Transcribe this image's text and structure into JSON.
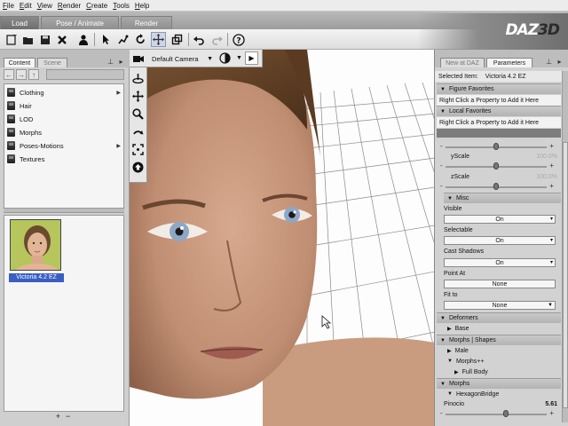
{
  "menu": [
    "File",
    "Edit",
    "View",
    "Render",
    "Create",
    "Tools",
    "Help"
  ],
  "main_tabs": [
    {
      "label": "Load",
      "active": true
    },
    {
      "label": "Pose / Animate",
      "active": false
    },
    {
      "label": "Render",
      "active": false
    }
  ],
  "brand": {
    "part1": "DAZ",
    "part2": "3D"
  },
  "toolbar_icons": [
    "new-scene-icon",
    "open-icon",
    "save-icon",
    "delete-icon",
    "figure-setup-icon",
    "select-tool-icon",
    "node-tool-icon",
    "rotate-tool-icon",
    "translate-tool-icon",
    "scale-tool-icon",
    "undo-icon",
    "redo-icon",
    "help-icon"
  ],
  "left_panel": {
    "tabs": [
      {
        "label": "Content",
        "active": true
      },
      {
        "label": "Scene",
        "active": false
      }
    ],
    "folders": [
      {
        "label": "Clothing",
        "has_children": true
      },
      {
        "label": "Hair",
        "has_children": false
      },
      {
        "label": "LOD",
        "has_children": false
      },
      {
        "label": "Morphs",
        "has_children": false
      },
      {
        "label": "Poses-Motions",
        "has_children": true
      },
      {
        "label": "Textures",
        "has_children": false
      }
    ],
    "thumbnail": {
      "caption": "Victoria 4.2 EZ"
    },
    "add_label": "+",
    "remove_label": "−"
  },
  "viewport": {
    "camera": "Default Camera"
  },
  "right_panel": {
    "tabs": [
      {
        "label": "New at DAZ",
        "active": false
      },
      {
        "label": "Parameters",
        "active": true
      }
    ],
    "selected_label": "Selected Item:",
    "selected_value": "Victoria 4.2 EZ",
    "figure_favorites": "Figure Favorites",
    "local_favorites": "Local Favorites",
    "favorites_hint": "Right Click a Property to Add it Here",
    "yscale": {
      "label": "yScale",
      "value": "100.0%",
      "level": 0.5
    },
    "zscale": {
      "label": "zScale",
      "value": "100.0%",
      "level": 0.5
    },
    "top_slider_level": 0.5,
    "misc": "Misc",
    "visible": {
      "label": "Visible",
      "value": "On"
    },
    "selectable": {
      "label": "Selectable",
      "value": "On"
    },
    "cast_shadows": {
      "label": "Cast Shadows",
      "value": "On"
    },
    "point_at": {
      "label": "Point At",
      "value": "None"
    },
    "fit_to": {
      "label": "Fit to",
      "value": "None"
    },
    "deformers": "Deformers",
    "base": "Base",
    "morphs_shapes": "Morphs | Shapes",
    "male": "Male",
    "morphs_pp": "Morphs++",
    "full_body": "Full Body",
    "morphs": "Morphs",
    "hexagon_bridge": "HexagonBridge",
    "pinocio": {
      "label": "Pinocio",
      "value": "5.61",
      "level": 0.6
    }
  },
  "colors": {
    "selection": "#3a5ec2",
    "panel": "#d2d2d2"
  }
}
